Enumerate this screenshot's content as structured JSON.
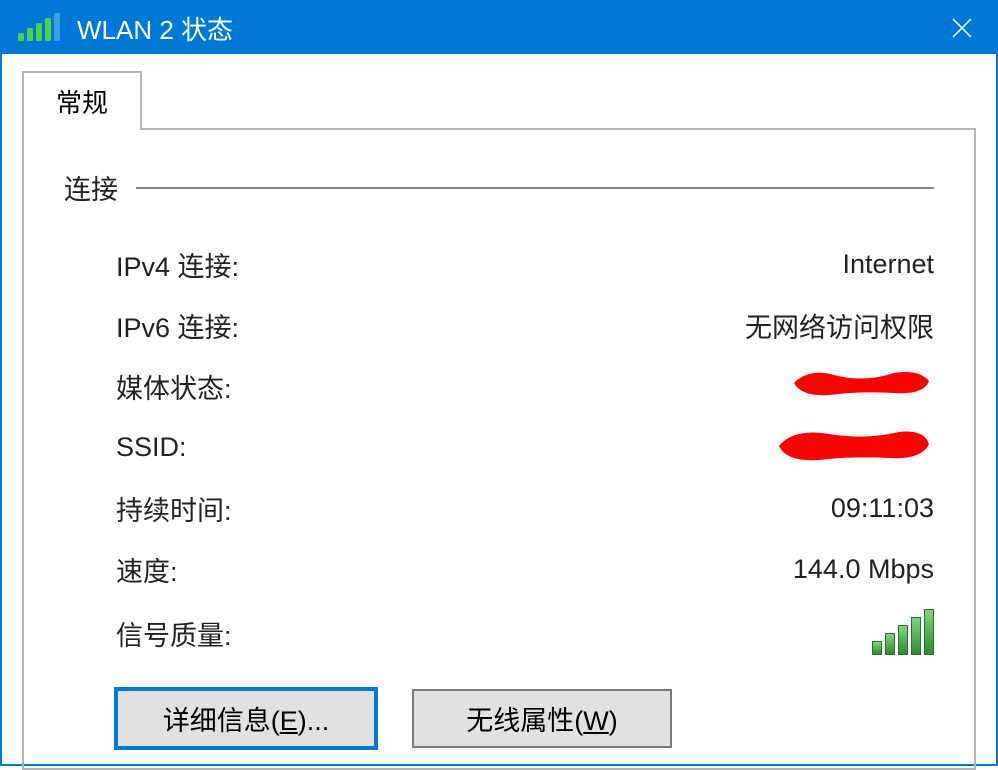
{
  "titlebar": {
    "title": "WLAN 2 状态"
  },
  "tabs": {
    "general": "常规"
  },
  "section": {
    "connection": "连接"
  },
  "fields": {
    "ipv4_label": "IPv4 连接:",
    "ipv4_value": "Internet",
    "ipv6_label": "IPv6 连接:",
    "ipv6_value": "无网络访问权限",
    "media_state_label": "媒体状态:",
    "ssid_label": "SSID:",
    "duration_label": "持续时间:",
    "duration_value": "09:11:03",
    "speed_label": "速度:",
    "speed_value": "144.0 Mbps",
    "signal_quality_label": "信号质量:"
  },
  "buttons": {
    "details_prefix": "详细信息(",
    "details_key": "E",
    "details_suffix": ")...",
    "wireless_prefix": "无线属性(",
    "wireless_key": "W",
    "wireless_suffix": ")"
  }
}
